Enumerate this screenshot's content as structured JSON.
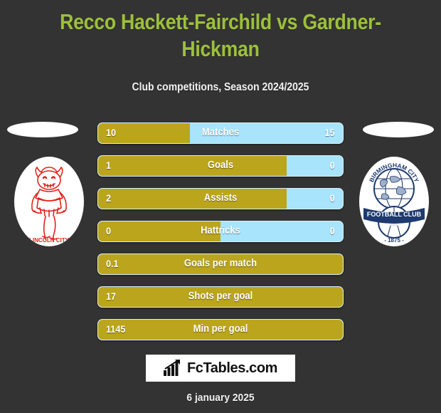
{
  "header": {
    "title": "Recco Hackett-Fairchild vs Gardner-Hickman",
    "subtitle": "Club competitions, Season 2024/2025"
  },
  "teams": {
    "home": {
      "name": "Lincoln City",
      "crest_text": "LINCOLN CITY",
      "color": "#e2231a"
    },
    "away": {
      "name": "Birmingham City",
      "crest_text_top": "BIRMINGHAM CITY",
      "crest_text_mid": "FOOTBALL CLUB",
      "crest_year": "- 1875 -",
      "color": "#1e3a6e"
    }
  },
  "footer": {
    "logo_text": "FcTables.com",
    "logo_icon": "bar-chart-up-icon",
    "date": "6 january 2025"
  },
  "colors": {
    "background": "#333333",
    "title": "#9dc03a",
    "home_bar": "#bba51c",
    "away_bar": "#a8e4fb",
    "text": "#ffffff"
  },
  "chart_data": {
    "type": "bar",
    "title": "Recco Hackett-Fairchild vs Gardner-Hickman",
    "subtitle": "Club competitions, Season 2024/2025",
    "orientation": "horizontal-diverging",
    "series": [
      {
        "name": "Recco Hackett-Fairchild",
        "side": "left",
        "color": "#bba51c"
      },
      {
        "name": "Gardner-Hickman",
        "side": "right",
        "color": "#a8e4fb"
      }
    ],
    "categories": [
      "Matches",
      "Goals",
      "Assists",
      "Hattricks",
      "Goals per match",
      "Shots per goal",
      "Min per goal"
    ],
    "rows": [
      {
        "label": "Matches",
        "home": "10",
        "away": "15",
        "home_pct": 37.5,
        "two_sided": true
      },
      {
        "label": "Goals",
        "home": "1",
        "away": "0",
        "home_pct": 77,
        "two_sided": true
      },
      {
        "label": "Assists",
        "home": "2",
        "away": "0",
        "home_pct": 77,
        "two_sided": true
      },
      {
        "label": "Hattricks",
        "home": "0",
        "away": "0",
        "home_pct": 50,
        "two_sided": true
      },
      {
        "label": "Goals per match",
        "home": "0.1",
        "away": "",
        "home_pct": 100,
        "two_sided": false
      },
      {
        "label": "Shots per goal",
        "home": "17",
        "away": "",
        "home_pct": 100,
        "two_sided": false
      },
      {
        "label": "Min per goal",
        "home": "1145",
        "away": "",
        "home_pct": 100,
        "two_sided": false
      }
    ]
  }
}
